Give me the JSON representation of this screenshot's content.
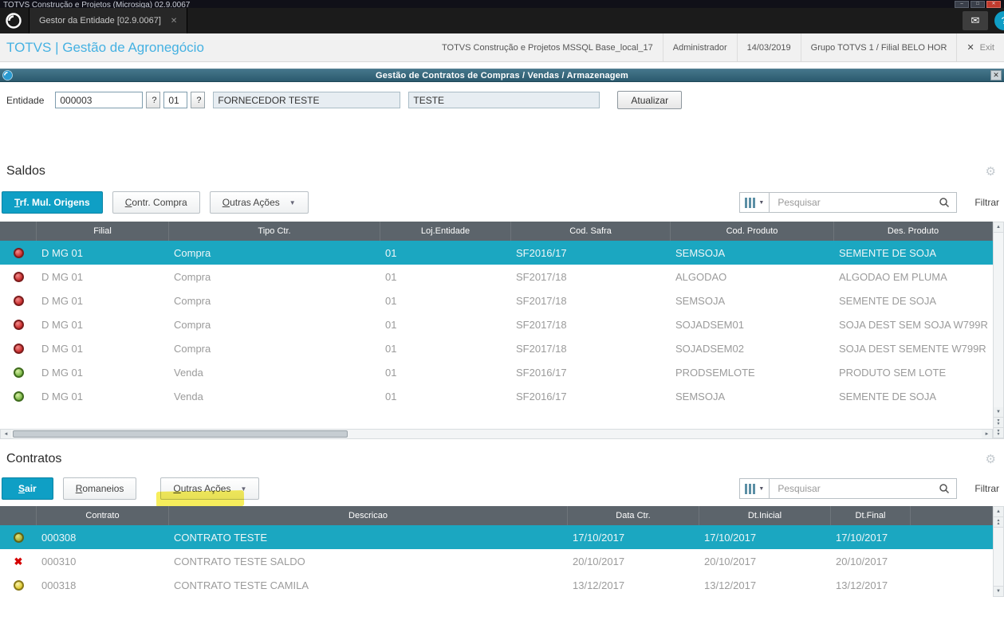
{
  "window": {
    "title": "TOTVS Construção e Projetos (Microsiga) 02.9.0067"
  },
  "icons": {
    "minimize": "–",
    "maximize": "□",
    "close": "✕",
    "mail": "✉",
    "gear": "⚙",
    "caret_down": "▼",
    "up": "▲",
    "down": "▼",
    "left": "◄",
    "right": "►",
    "question": "?",
    "x_mark": "✖"
  },
  "tabbar": {
    "tab_label": "Gestor da Entidade [02.9.0067]",
    "tab_close": "✕"
  },
  "header": {
    "brand": "TOTVS | Gestão de Agronegócio",
    "environment": "TOTVS Construção e Projetos MSSQL Base_local_17",
    "user": "Administrador",
    "date": "14/03/2019",
    "branch": "Grupo TOTVS 1 / Filial BELO HOR",
    "exit_x": "✕",
    "exit_label": "Exit"
  },
  "dialog": {
    "title": "Gestão de Contratos de Compras / Vendas / Armazenagem",
    "close": "✕"
  },
  "form": {
    "label": "Entidade",
    "code": "000003",
    "store": "01",
    "name": "FORNECEDOR TESTE",
    "short_name": "TESTE",
    "refresh": "Atualizar"
  },
  "saldos": {
    "title": "Saldos",
    "btn_trf": "Trf. Mul. Origens",
    "btn_contr": "Contr. Compra",
    "btn_outras": "Outras Ações",
    "search_placeholder": "Pesquisar",
    "filter": "Filtrar",
    "columns": [
      "",
      "Filial",
      "Tipo Ctr.",
      "Loj.Entidade",
      "Cod. Safra",
      "Cod. Produto",
      "Des. Produto"
    ],
    "rows": [
      {
        "selected": true,
        "status": "red",
        "cells": [
          "D MG 01",
          "Compra",
          "01",
          "SF2016/17",
          "SEMSOJA",
          "SEMENTE DE SOJA"
        ]
      },
      {
        "selected": false,
        "status": "red",
        "cells": [
          "D MG 01",
          "Compra",
          "01",
          "SF2017/18",
          "ALGODAO",
          "ALGODAO EM PLUMA"
        ]
      },
      {
        "selected": false,
        "status": "red",
        "cells": [
          "D MG 01",
          "Compra",
          "01",
          "SF2017/18",
          "SEMSOJA",
          "SEMENTE DE SOJA"
        ]
      },
      {
        "selected": false,
        "status": "red",
        "cells": [
          "D MG 01",
          "Compra",
          "01",
          "SF2017/18",
          "SOJADSEM01",
          "SOJA DEST SEM SOJA W799R"
        ]
      },
      {
        "selected": false,
        "status": "red",
        "cells": [
          "D MG 01",
          "Compra",
          "01",
          "SF2017/18",
          "SOJADSEM02",
          "SOJA DEST SEMENTE W799R"
        ]
      },
      {
        "selected": false,
        "status": "green",
        "cells": [
          "D MG 01",
          "Venda",
          "01",
          "SF2016/17",
          "PRODSEMLOTE",
          "PRODUTO SEM LOTE"
        ]
      },
      {
        "selected": false,
        "status": "green",
        "cells": [
          "D MG 01",
          "Venda",
          "01",
          "SF2016/17",
          "SEMSOJA",
          "SEMENTE DE SOJA"
        ]
      }
    ]
  },
  "contratos": {
    "title": "Contratos",
    "btn_sair": "Sair",
    "btn_romaneios": "Romaneios",
    "btn_outras": "Outras Ações",
    "search_placeholder": "Pesquisar",
    "filter": "Filtrar",
    "columns": [
      "",
      "Contrato",
      "Descricao",
      "Data Ctr.",
      "Dt.Inicial",
      "Dt.Final",
      ""
    ],
    "rows": [
      {
        "selected": true,
        "status": "olive",
        "cells": [
          "000308",
          "CONTRATO TESTE",
          "17/10/2017",
          "17/10/2017",
          "17/10/2017",
          ""
        ]
      },
      {
        "selected": false,
        "status": "x",
        "cells": [
          "000310",
          "CONTRATO TESTE SALDO",
          "20/10/2017",
          "20/10/2017",
          "20/10/2017",
          ""
        ]
      },
      {
        "selected": false,
        "status": "yellow",
        "cells": [
          "000318",
          "CONTRATO TESTE CAMILA",
          "13/12/2017",
          "13/12/2017",
          "13/12/2017",
          ""
        ]
      }
    ]
  }
}
